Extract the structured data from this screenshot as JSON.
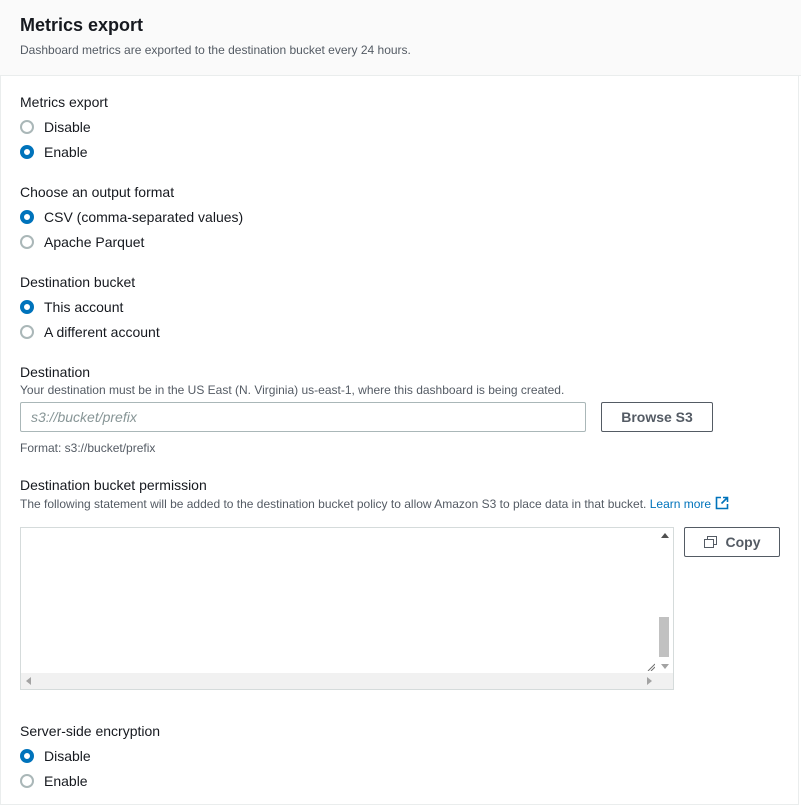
{
  "header": {
    "title": "Metrics export",
    "description": "Dashboard metrics are exported to the destination bucket every 24 hours."
  },
  "metrics_export": {
    "label": "Metrics export",
    "options": [
      {
        "label": "Disable",
        "checked": false
      },
      {
        "label": "Enable",
        "checked": true
      }
    ]
  },
  "output_format": {
    "label": "Choose an output format",
    "options": [
      {
        "label": "CSV (comma-separated values)",
        "checked": true
      },
      {
        "label": "Apache Parquet",
        "checked": false
      }
    ]
  },
  "destination_bucket": {
    "label": "Destination bucket",
    "options": [
      {
        "label": "This account",
        "checked": true
      },
      {
        "label": "A different account",
        "checked": false
      }
    ]
  },
  "destination": {
    "label": "Destination",
    "description": "Your destination must be in the US East (N. Virginia) us-east-1, where this dashboard is being created.",
    "placeholder": "s3://bucket/prefix",
    "value": "",
    "browse_label": "Browse S3",
    "format_hint": "Format: s3://bucket/prefix"
  },
  "permission": {
    "label": "Destination bucket permission",
    "description": "The following statement will be added to the destination bucket policy to allow Amazon S3 to place data in that bucket.",
    "learn_more": "Learn more",
    "policy_text": "",
    "copy_label": "Copy"
  },
  "encryption": {
    "label": "Server-side encryption",
    "options": [
      {
        "label": "Disable",
        "checked": true
      },
      {
        "label": "Enable",
        "checked": false
      }
    ]
  },
  "icons": {
    "external_link": "external-link-icon",
    "copy": "copy-icon"
  },
  "colors": {
    "accent": "#0073bb",
    "text": "#16191f",
    "secondary_text": "#545b64",
    "header_bg": "#fafafa"
  }
}
